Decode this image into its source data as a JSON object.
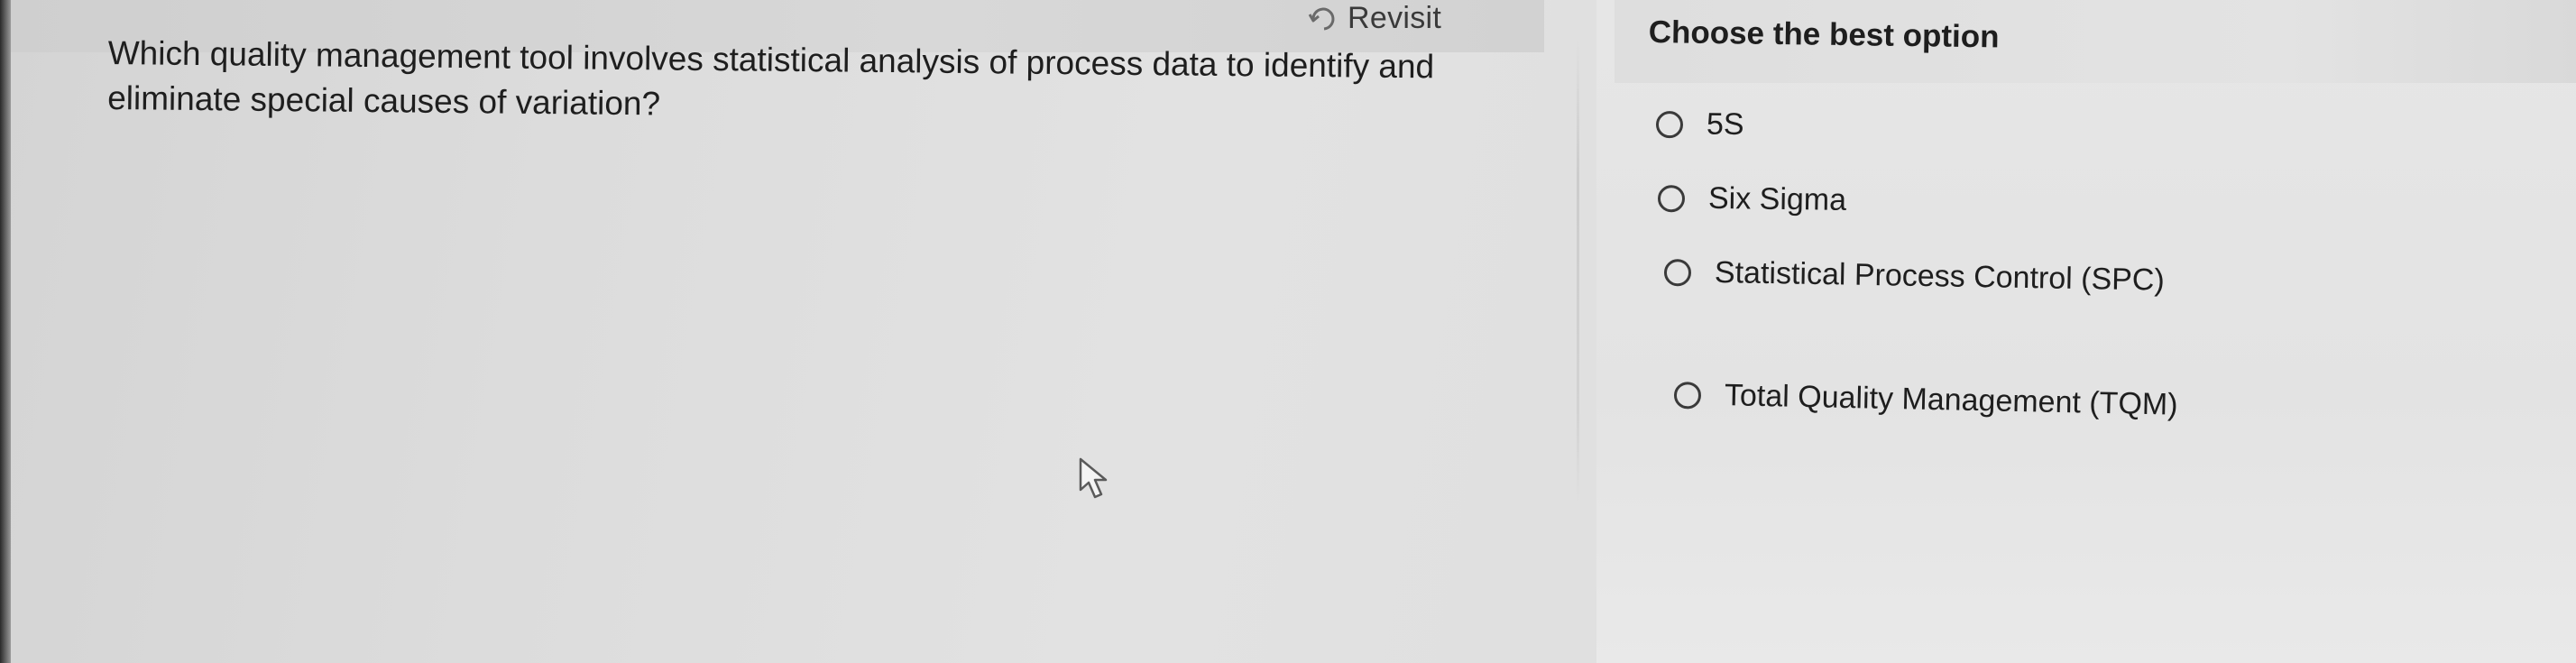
{
  "header": {
    "revisit_label": "Revisit",
    "revisit_icon": "revisit-icon"
  },
  "question": {
    "text": "Which quality management tool involves statistical analysis of process data to identify and eliminate special causes of variation?"
  },
  "answer_panel": {
    "title": "Choose the best option",
    "options": [
      {
        "label": "5S",
        "selected": false
      },
      {
        "label": "Six Sigma",
        "selected": false
      },
      {
        "label": "Statistical Process Control (SPC)",
        "selected": false
      },
      {
        "label": "Total Quality Management (TQM)",
        "selected": false
      }
    ]
  },
  "colors": {
    "text": "#1e1e1e",
    "background": "#e0e0e0",
    "radio_border": "#3a3a3a"
  }
}
